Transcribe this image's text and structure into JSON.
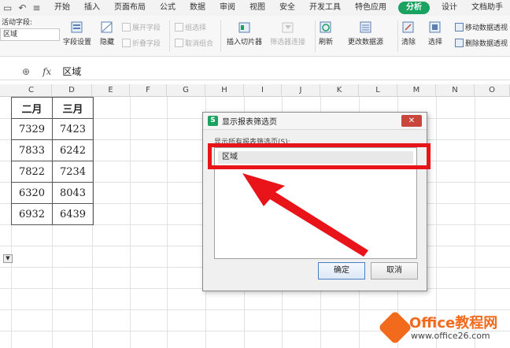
{
  "menubar": {
    "items": [
      {
        "label": "开始"
      },
      {
        "label": "插入"
      },
      {
        "label": "页面布局"
      },
      {
        "label": "公式"
      },
      {
        "label": "数据"
      },
      {
        "label": "审阅"
      },
      {
        "label": "视图"
      },
      {
        "label": "安全"
      },
      {
        "label": "开发工具"
      },
      {
        "label": "特色应用"
      },
      {
        "label": "分析"
      },
      {
        "label": "设计"
      },
      {
        "label": "文档助手"
      }
    ],
    "active": "分析"
  },
  "ribbon": {
    "field_label": "活动字段:",
    "field_value": "区域",
    "field_settings": "字段设置",
    "hide": "隐藏",
    "expand_field": "展开字段",
    "collapse_field": "折叠字段",
    "group_selection": "组选择",
    "ungroup": "取消组合",
    "insert_slicer": "插入切片器",
    "filter_connection": "筛选器连接",
    "refresh": "刷新",
    "change_source": "更改数据源",
    "clear": "清除",
    "select": "选择",
    "move_pivot": "移动数据透视",
    "delete_pivot": "删除数据透视"
  },
  "formula": {
    "fx": "fx",
    "value": "区域"
  },
  "columns": [
    "C",
    "D",
    "E",
    "F",
    "G",
    "H",
    "I",
    "J",
    "K",
    "L",
    "M",
    "N",
    "O"
  ],
  "table": {
    "headers": [
      "二月",
      "三月"
    ],
    "rows": [
      [
        "7329",
        "7423"
      ],
      [
        "7833",
        "6242"
      ],
      [
        "7822",
        "7234"
      ],
      [
        "6320",
        "8043"
      ],
      [
        "6932",
        "6439"
      ]
    ]
  },
  "dialog": {
    "title": "显示报表筛选页",
    "logo": "S",
    "close": "✕",
    "label": "显示所有报表筛选页(S):",
    "list_item": "区域",
    "ok": "确定",
    "cancel": "取消"
  },
  "watermark": {
    "title": "Office教程网",
    "url": "www.office26.com"
  },
  "colors": {
    "accent": "#1aa260",
    "annotation": "#e8141a",
    "watermark": "#f26a1b"
  }
}
